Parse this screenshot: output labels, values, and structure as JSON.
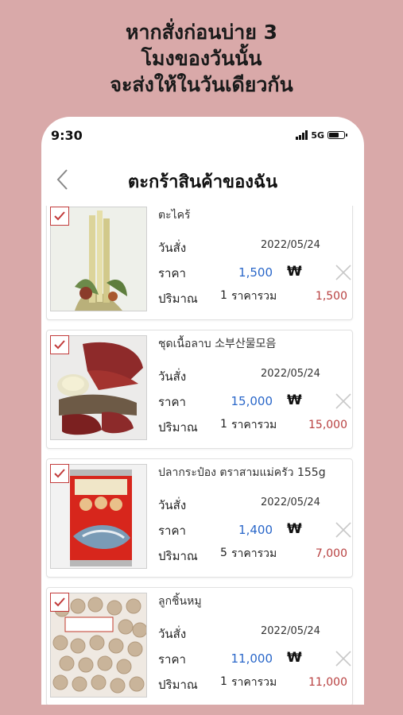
{
  "promo": {
    "line1": "หากสั่งก่อนบ่าย 3",
    "line2": "โมงของวันนั้น",
    "line3": "จะส่งให้ในวันเดียวกัน"
  },
  "status_bar": {
    "time": "9:30",
    "network": "5G"
  },
  "nav": {
    "title": "ตะกร้าสินค้าของฉัน"
  },
  "labels": {
    "order_date": "วันสั่ง",
    "price": "ราคา",
    "quantity": "ปริมาณ",
    "total": "ราคารวม",
    "currency": "₩"
  },
  "items": [
    {
      "name": "ตะไคร้",
      "date": "2022/05/24",
      "price": "1,500",
      "qty": "1",
      "total": "1,500",
      "checked": true,
      "image_icon": "lemongrass-image"
    },
    {
      "name": "ชุดเนื้อลาบ 소부산물모음",
      "date": "2022/05/24",
      "price": "15,000",
      "qty": "1",
      "total": "15,000",
      "checked": true,
      "image_icon": "beef-set-image"
    },
    {
      "name": "ปลากระป๋อง ตราสามแม่ครัว 155g",
      "date": "2022/05/24",
      "price": "1,400",
      "qty": "5",
      "total": "7,000",
      "checked": true,
      "image_icon": "canned-fish-image"
    },
    {
      "name": "ลูกชิ้นหมู",
      "date": "2022/05/24",
      "price": "11,000",
      "qty": "1",
      "total": "11,000",
      "checked": true,
      "image_icon": "pork-balls-image"
    }
  ],
  "colors": {
    "background": "#d9a9a9",
    "accent": "#c23b3b",
    "price_blue": "#2a67c9",
    "total_red": "#b84040"
  }
}
